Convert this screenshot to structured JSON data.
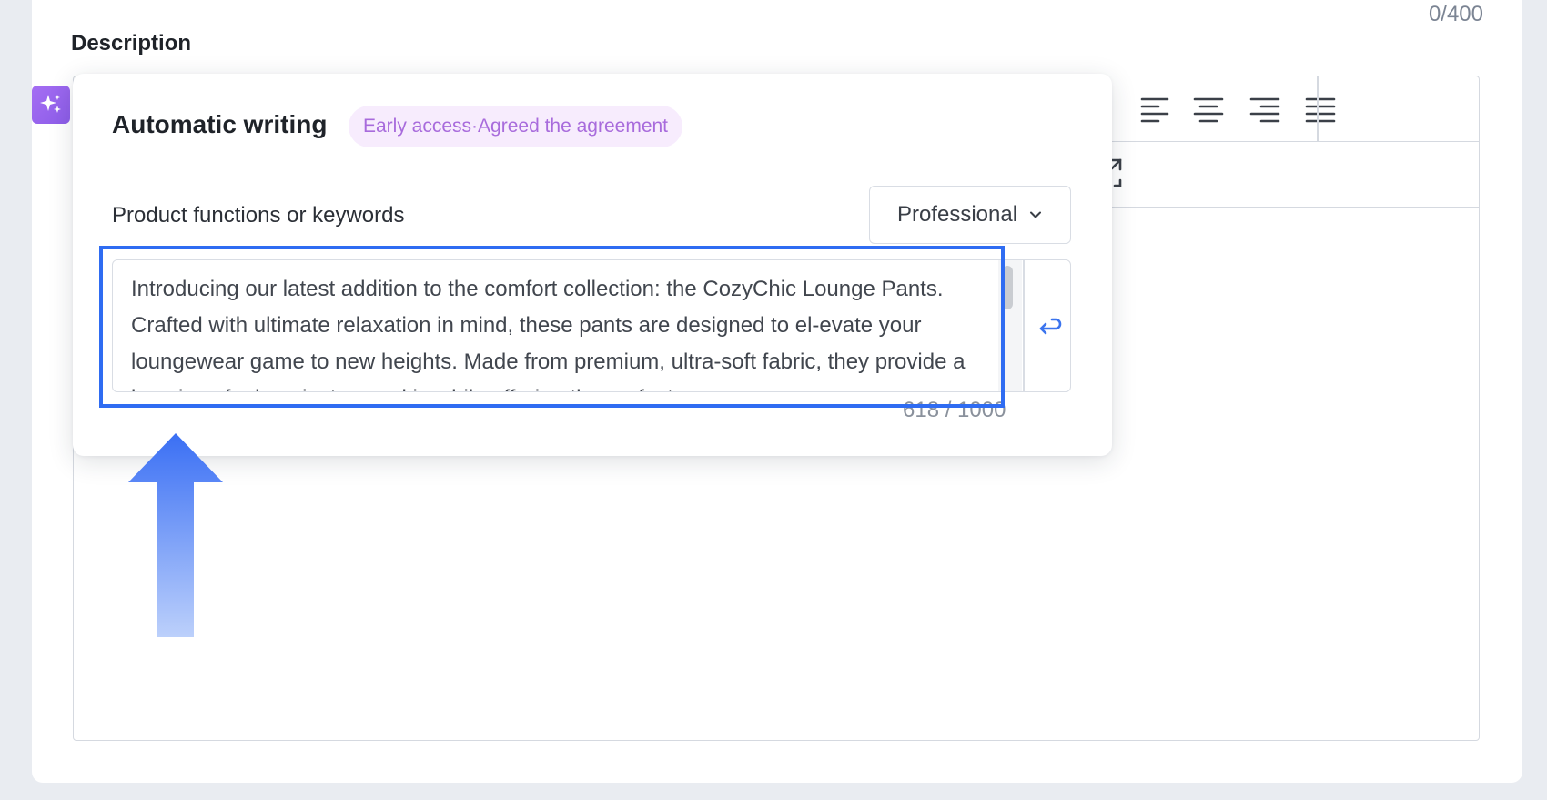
{
  "description_field": {
    "label": "Description",
    "char_counter": "0/400"
  },
  "editor_toolbar": {
    "icons": [
      "align-left-icon",
      "align-center-icon",
      "align-right-icon",
      "align-justify-icon",
      "expand-icon"
    ]
  },
  "auto_writing": {
    "title": "Automatic writing",
    "tag": "Early access·Agreed the agreement",
    "field_label": "Product functions or keywords",
    "style_select": {
      "selected": "Professional"
    },
    "text_value": "Introducing our latest addition to the comfort collection: the CozyChic Lounge Pants. Crafted with ultimate relaxation in mind, these pants are designed to el-evate your loungewear game to new heights. Made from premium, ultra-soft fabric, they provide a luxurious feel against your skin while offering the perfect",
    "char_count": "618 / 1000"
  },
  "colors": {
    "accent": "#2f6cf2",
    "ai_purple": "#9a63ee",
    "tag_bg": "#f7ecfd",
    "tag_text": "#a86bdc"
  }
}
